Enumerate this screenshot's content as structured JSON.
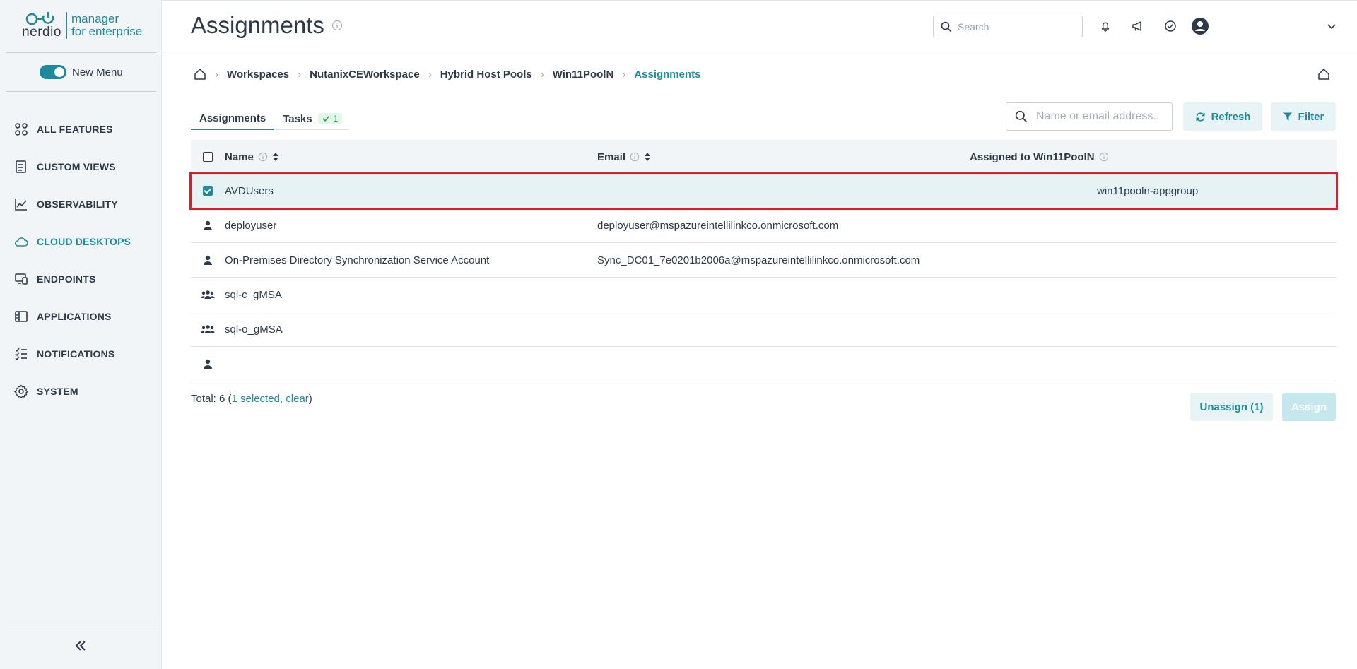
{
  "colors": {
    "accent": "#1f8a9c",
    "sidebar_bg": "#f2f5f7",
    "selection_outline": "#d71f2b",
    "success": "#2b9b4a"
  },
  "brand": {
    "word": "nerdio",
    "line1": "manager",
    "line2": "for enterprise"
  },
  "sidebar": {
    "toggle_label": "New Menu",
    "items": [
      {
        "label": "ALL FEATURES",
        "icon": "grid-icon"
      },
      {
        "label": "CUSTOM VIEWS",
        "icon": "custom-views-icon"
      },
      {
        "label": "OBSERVABILITY",
        "icon": "chart-line-icon"
      },
      {
        "label": "CLOUD DESKTOPS",
        "icon": "cloud-icon"
      },
      {
        "label": "ENDPOINTS",
        "icon": "devices-icon"
      },
      {
        "label": "APPLICATIONS",
        "icon": "applications-icon"
      },
      {
        "label": "NOTIFICATIONS",
        "icon": "checklist-icon"
      },
      {
        "label": "SYSTEM",
        "icon": "gear-icon"
      }
    ]
  },
  "header": {
    "title": "Assignments",
    "search_placeholder": "Search"
  },
  "breadcrumb": [
    "Workspaces",
    "NutanixCEWorkspace",
    "Hybrid Host Pools",
    "Win11PoolN",
    "Assignments"
  ],
  "tabs": [
    {
      "label": "Assignments"
    },
    {
      "label": "Tasks",
      "badge": "1"
    }
  ],
  "toolbar": {
    "search_placeholder": "Name or email address..",
    "refresh_label": "Refresh",
    "filter_label": "Filter"
  },
  "table": {
    "columns": {
      "name": "Name",
      "email": "Email",
      "assigned": "Assigned to Win11PoolN"
    },
    "rows": [
      {
        "type": "checkbox-checked",
        "name": "AVDUsers",
        "email": "",
        "assigned": "win11pooln-appgroup"
      },
      {
        "type": "user-icon",
        "name": "deployuser",
        "email": "deployuser@mspazureintellilinkco.onmicrosoft.com",
        "assigned": ""
      },
      {
        "type": "user-icon",
        "name": "On-Premises Directory Synchronization Service Account",
        "email": "Sync_DC01_7e0201b2006a@mspazureintellilinkco.onmicrosoft.com",
        "assigned": ""
      },
      {
        "type": "group-icon",
        "name": "sql-c_gMSA",
        "email": "",
        "assigned": ""
      },
      {
        "type": "group-icon",
        "name": "sql-o_gMSA",
        "email": "",
        "assigned": ""
      },
      {
        "type": "user-icon",
        "name": "",
        "email": "",
        "assigned": ""
      }
    ]
  },
  "footer": {
    "total_prefix": "Total: 6 (",
    "selected_text": "1 selected",
    "comma": ", ",
    "clear_text": "clear",
    "suffix": ")",
    "unassign_label": "Unassign (1)",
    "assign_label": "Assign"
  }
}
